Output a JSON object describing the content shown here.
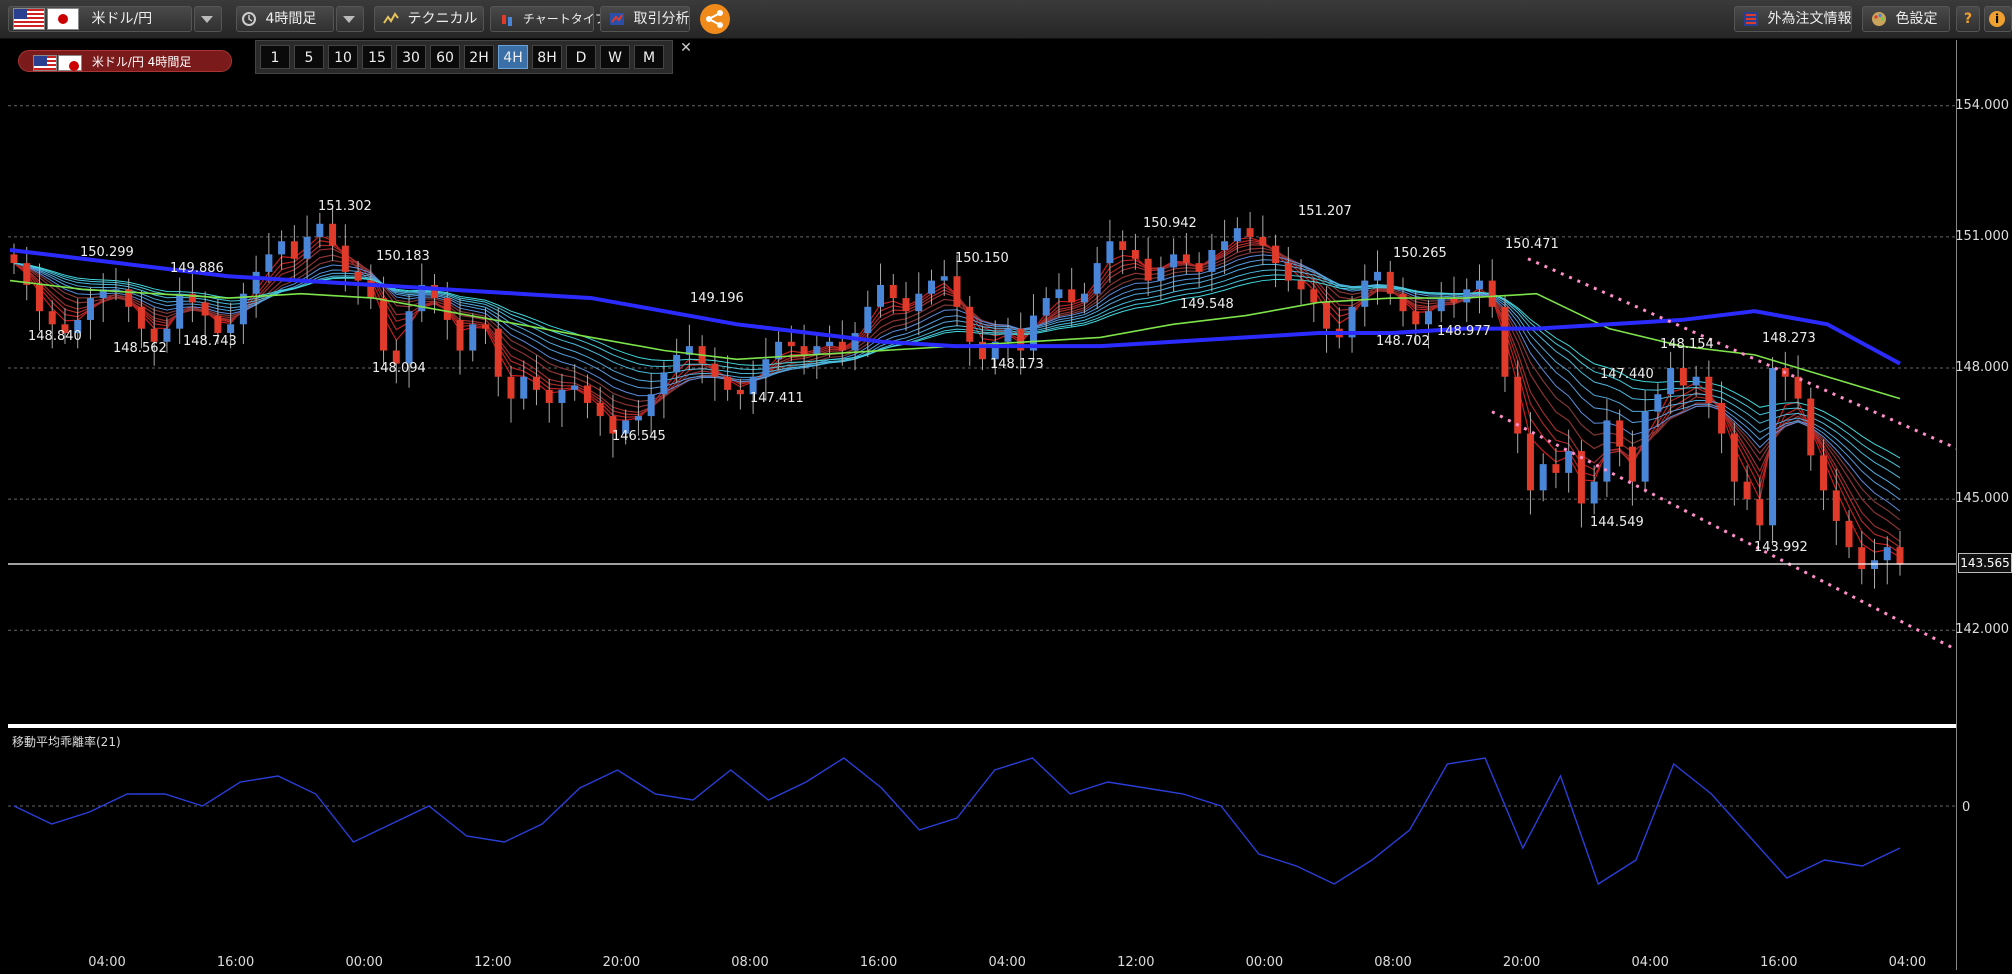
{
  "toolbar": {
    "symbol_label": "米ドル/円",
    "period_label": "4時間足",
    "technical_label": "テクニカル",
    "chart_type_label": "チャートタイプ",
    "analysis_label": "取引分析",
    "fx_order_info_label": "外為注文情報",
    "color_setting_label": "色設定",
    "help_label": "?",
    "info_label": "i"
  },
  "badge": {
    "label": "米ドル/円 4時間足"
  },
  "timeframes": [
    "1",
    "5",
    "10",
    "15",
    "30",
    "60",
    "2H",
    "4H",
    "8H",
    "D",
    "W",
    "M"
  ],
  "active_timeframe": "4H",
  "price_axis": [
    "154.000",
    "151.000",
    "148.000",
    "145.000",
    "142.000"
  ],
  "last_price": "143.565",
  "time_axis": [
    "04:00",
    "16:00",
    "00:00",
    "12:00",
    "20:00",
    "08:00",
    "16:00",
    "04:00",
    "12:00",
    "00:00",
    "08:00",
    "20:00",
    "04:00",
    "16:00",
    "04:00"
  ],
  "annotations": [
    "148.840",
    "150.299",
    "148.562",
    "149.886",
    "148.743",
    "151.302",
    "150.183",
    "148.094",
    "149.196",
    "146.545",
    "147.411",
    "150.150",
    "148.173",
    "150.942",
    "149.548",
    "151.207",
    "148.702",
    "150.265",
    "148.977",
    "150.471",
    "147.440",
    "148.154",
    "144.549",
    "148.273",
    "143.992"
  ],
  "sub_indicator": {
    "title": "移動平均乖離率(21)",
    "zero_label": "0"
  },
  "colors": {
    "up_candle": "#4a86d8",
    "down_candle": "#e03a2a",
    "long_ma": "#2b2bff",
    "mid_ma": "#7ee34a",
    "channel": "#ff8fc8",
    "deviation_line": "#2a3ed8"
  },
  "chart_data": {
    "type": "candlestick",
    "symbol": "米ドル/円",
    "timeframe": "4H",
    "ylim": [
      140,
      155
    ],
    "close_path": [
      150.4,
      149.9,
      149.3,
      149.0,
      148.8,
      149.1,
      149.6,
      149.8,
      149.8,
      149.4,
      148.9,
      148.6,
      148.9,
      149.7,
      149.5,
      149.2,
      148.8,
      149.0,
      149.7,
      150.2,
      150.6,
      150.9,
      150.5,
      151.0,
      151.3,
      150.8,
      150.2,
      150.0,
      149.6,
      148.4,
      148.1,
      149.3,
      149.9,
      149.6,
      149.1,
      148.4,
      149.0,
      148.9,
      147.8,
      147.3,
      147.8,
      147.5,
      147.2,
      147.5,
      147.6,
      147.2,
      146.9,
      146.5,
      146.8,
      146.9,
      147.4,
      147.9,
      148.3,
      148.5,
      148.1,
      147.8,
      147.5,
      147.4,
      147.8,
      148.2,
      148.6,
      148.5,
      148.3,
      148.5,
      148.6,
      148.4,
      148.8,
      149.4,
      149.9,
      149.6,
      149.3,
      149.7,
      150.0,
      150.1,
      149.4,
      148.6,
      148.2,
      148.6,
      148.9,
      148.4,
      149.2,
      149.6,
      149.8,
      149.5,
      149.7,
      150.4,
      150.9,
      150.7,
      150.5,
      150.0,
      150.3,
      150.6,
      150.4,
      150.2,
      150.7,
      150.9,
      151.2,
      151.0,
      150.8,
      150.4,
      150.0,
      149.8,
      149.5,
      148.9,
      148.7,
      149.4,
      150.0,
      150.2,
      149.7,
      149.3,
      149.0,
      149.3,
      149.6,
      149.5,
      149.8,
      150.0,
      149.4,
      147.8,
      146.5,
      145.2,
      145.8,
      145.6,
      146.1,
      144.9,
      145.4,
      146.8,
      146.2,
      145.4,
      147.0,
      147.4,
      148.0,
      147.6,
      147.8,
      147.2,
      146.5,
      145.4,
      145.0,
      144.4,
      148.0,
      147.8,
      147.3,
      146.0,
      145.2,
      144.5,
      143.9,
      143.4,
      143.6,
      143.9,
      143.5
    ],
    "long_ma": [
      150.7,
      150.5,
      150.3,
      150.1,
      150.0,
      149.9,
      149.8,
      149.7,
      149.6,
      149.3,
      149.0,
      148.8,
      148.6,
      148.5,
      148.5,
      148.5,
      148.6,
      148.7,
      148.8,
      148.8,
      148.9,
      148.9,
      149.0,
      149.1,
      149.3,
      149.0,
      148.1
    ],
    "mid_ma": [
      150.0,
      149.8,
      149.7,
      149.6,
      149.7,
      149.6,
      149.3,
      149.0,
      148.7,
      148.4,
      148.2,
      148.3,
      148.4,
      148.5,
      148.6,
      148.7,
      149.0,
      149.2,
      149.5,
      149.6,
      149.6,
      149.7,
      148.9,
      148.5,
      148.3,
      147.8,
      147.3
    ],
    "deviation": [
      0.0,
      -0.3,
      -0.1,
      0.2,
      0.2,
      0.0,
      0.4,
      0.5,
      0.2,
      -0.6,
      -0.3,
      0.0,
      -0.5,
      -0.6,
      -0.3,
      0.3,
      0.6,
      0.2,
      0.1,
      0.6,
      0.1,
      0.4,
      0.8,
      0.3,
      -0.4,
      -0.2,
      0.6,
      0.8,
      0.2,
      0.4,
      0.3,
      0.2,
      0.0,
      -0.8,
      -1.0,
      -1.3,
      -0.9,
      -0.4,
      0.7,
      0.8,
      -0.7,
      0.5,
      -1.3,
      -0.9,
      0.7,
      0.2,
      -0.5,
      -1.2,
      -0.9,
      -1.0,
      -0.7
    ]
  }
}
